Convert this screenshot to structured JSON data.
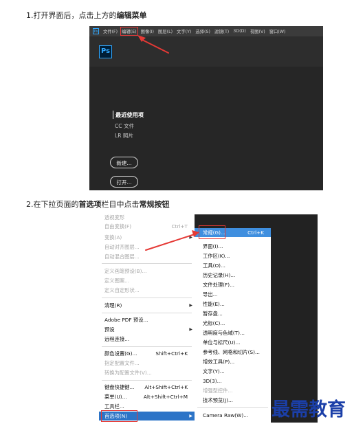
{
  "steps": {
    "step1": {
      "prefix": "1.打开界面后，点击上方的",
      "bold": "编辑菜单"
    },
    "step2": {
      "prefix": "2.在下拉页面的",
      "bold1": "首选项",
      "middle": "栏目中点击",
      "bold2": "常规按钮"
    }
  },
  "photoshop": {
    "mini_logo": "Ps",
    "menubar": [
      "文件(F)",
      "编辑(E)",
      "图像(I)",
      "图层(L)",
      "文字(Y)",
      "选择(S)",
      "滤镜(T)",
      "3D(D)",
      "视图(V)",
      "窗口(W)"
    ],
    "logo": "Ps",
    "recent_heading": "最近使用项",
    "cc_files": "CC 文件",
    "lr_photos": "LR 照片",
    "new_button": "新建...",
    "open_button": "打开..."
  },
  "edit_menu": {
    "items": [
      {
        "label": "透视变形",
        "shortcut": "",
        "enabled": false
      },
      {
        "label": "自由变换(F)",
        "shortcut": "Ctrl+T",
        "enabled": false
      },
      {
        "label": "变换(A)",
        "shortcut": "",
        "enabled": false
      },
      {
        "label": "自动对齐图层...",
        "shortcut": "",
        "enabled": false
      },
      {
        "label": "自动混合图层...",
        "shortcut": "",
        "enabled": false
      },
      {
        "label": "定义画笔预设(B)...",
        "shortcut": "",
        "enabled": false
      },
      {
        "label": "定义图案...",
        "shortcut": "",
        "enabled": false
      },
      {
        "label": "定义自定形状...",
        "shortcut": "",
        "enabled": false
      },
      {
        "label": "清理(R)",
        "shortcut": "",
        "enabled": true
      },
      {
        "label": "Adobe PDF 预设...",
        "shortcut": "",
        "enabled": true
      },
      {
        "label": "预设",
        "shortcut": "",
        "enabled": true
      },
      {
        "label": "远程连接...",
        "shortcut": "",
        "enabled": true
      },
      {
        "label": "颜色设置(G)...",
        "shortcut": "Shift+Ctrl+K",
        "enabled": true
      },
      {
        "label": "指定配置文件...",
        "shortcut": "",
        "enabled": false
      },
      {
        "label": "转换为配置文件(V)...",
        "shortcut": "",
        "enabled": false
      },
      {
        "label": "键盘快捷键...",
        "shortcut": "Alt+Shift+Ctrl+K",
        "enabled": true
      },
      {
        "label": "菜单(U)...",
        "shortcut": "Alt+Shift+Ctrl+M",
        "enabled": true
      },
      {
        "label": "工具栏...",
        "shortcut": "",
        "enabled": true
      },
      {
        "label": "首选项(N)",
        "shortcut": "",
        "enabled": true
      }
    ]
  },
  "preferences_menu": {
    "items": [
      {
        "label": "常规(G)...",
        "shortcut": "Ctrl+K"
      },
      {
        "label": "界面(I)..."
      },
      {
        "label": "工作区(K)..."
      },
      {
        "label": "工具(O)..."
      },
      {
        "label": "历史记录(H)..."
      },
      {
        "label": "文件处理(F)..."
      },
      {
        "label": "导出..."
      },
      {
        "label": "性能(E)..."
      },
      {
        "label": "暂存盘..."
      },
      {
        "label": "光标(C)..."
      },
      {
        "label": "透明度与色域(T)..."
      },
      {
        "label": "单位与标尺(U)..."
      },
      {
        "label": "参考线、网格和切片(S)..."
      },
      {
        "label": "增效工具(P)..."
      },
      {
        "label": "文字(Y)..."
      },
      {
        "label": "3D(3)..."
      },
      {
        "label": "增强型控件..."
      },
      {
        "label": "技术预览(J)..."
      },
      {
        "label": "Camera Raw(W)..."
      }
    ]
  },
  "watermark": "最需教育",
  "colors": {
    "highlight": "#2c74c7",
    "annotation_red": "#e53935",
    "ps_blue": "#31a8ff",
    "watermark": "#1b3fa8"
  }
}
